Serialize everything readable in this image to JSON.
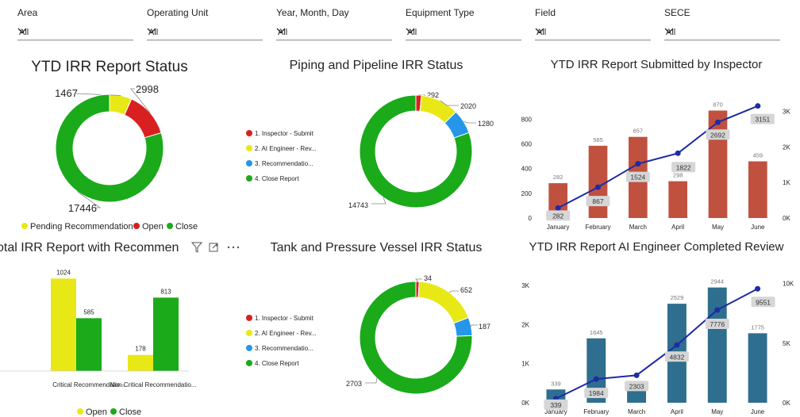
{
  "filters": [
    {
      "label": "Area",
      "value": "All"
    },
    {
      "label": "Operating Unit",
      "value": "All"
    },
    {
      "label": "Year, Month, Day",
      "value": "All"
    },
    {
      "label": "Equipment Type",
      "value": "All"
    },
    {
      "label": "Field",
      "value": "All"
    },
    {
      "label": "SECE",
      "value": "All"
    }
  ],
  "visual_header_icons": [
    "filter-icon",
    "focus-mode-icon",
    "more-options-icon"
  ],
  "colors": {
    "red": "#d92020",
    "yellow": "#e8e817",
    "green": "#1aaa1a",
    "blue": "#2596e8",
    "bar_red": "#c0513f",
    "bar_teal": "#2e6e8e",
    "line": "#1e2ba5"
  },
  "chart_data": [
    {
      "type": "pie",
      "title": "YTD IRR Report Status",
      "hole": "donut",
      "slices": [
        {
          "label": "Pending Recommendation",
          "value": 1467,
          "color": "#e8e817"
        },
        {
          "label": "Open",
          "value": 2998,
          "color": "#d92020"
        },
        {
          "label": "Close",
          "value": 17446,
          "color": "#1aaa1a"
        }
      ],
      "legend": [
        "Pending Recommendation",
        "Open",
        "Close"
      ],
      "legend_position": "bottom"
    },
    {
      "type": "pie",
      "title": "Piping and Pipeline IRR Status",
      "hole": "donut",
      "slices": [
        {
          "label": "1. Inspector - Submit",
          "value": 292,
          "color": "#d92020"
        },
        {
          "label": "2. AI Engineer - Rev...",
          "value": 2020,
          "color": "#e8e817"
        },
        {
          "label": "3. Recommendatio...",
          "value": 1280,
          "color": "#2596e8"
        },
        {
          "label": "4. Close Report",
          "value": 14743,
          "color": "#1aaa1a"
        }
      ],
      "legend": [
        "1. Inspector - Submit",
        "2. AI Engineer - Rev...",
        "3. Recommendatio...",
        "4. Close Report"
      ],
      "legend_position": "left"
    },
    {
      "type": "bar",
      "title": "YTD IRR Report Submitted by Inspector",
      "categories": [
        "January",
        "February",
        "March",
        "April",
        "May",
        "June"
      ],
      "series": [
        {
          "values": [
            282,
            585,
            657,
            298,
            870,
            459
          ],
          "kind": "bar",
          "color": "#c0513f"
        },
        {
          "values": [
            282,
            867,
            1524,
            1822,
            2692,
            3151
          ],
          "kind": "line",
          "color": "#1e2ba5"
        }
      ],
      "y_ticks": [
        "0",
        "200",
        "400",
        "600",
        "800"
      ],
      "y_max": 950,
      "y2_ticks": [
        "0K",
        "1K",
        "2K",
        "3K"
      ],
      "y2_max": 3300
    },
    {
      "type": "bar",
      "title": "Total IRR Report with Recommendations",
      "title_visible": "otal IRR Report with Recommen",
      "categories": [
        "Critical Recommendatio...",
        "Non-Critical Recommendatio..."
      ],
      "series": [
        {
          "name": "Open",
          "values": [
            1024,
            178
          ],
          "color": "#e8e817"
        },
        {
          "name": "Close",
          "values": [
            585,
            813
          ],
          "color": "#1aaa1a"
        }
      ],
      "legend": [
        "Open",
        "Close"
      ],
      "legend_position": "bottom",
      "y_max": 1080
    },
    {
      "type": "pie",
      "title": "Tank and Pressure Vessel IRR Status",
      "hole": "donut",
      "slices": [
        {
          "label": "1. Inspector - Submit",
          "value": 34,
          "color": "#d92020"
        },
        {
          "label": "2. AI Engineer - Rev...",
          "value": 652,
          "color": "#e8e817"
        },
        {
          "label": "3. Recommendatio...",
          "value": 187,
          "color": "#2596e8"
        },
        {
          "label": "4. Close Report",
          "value": 2703,
          "color": "#1aaa1a"
        }
      ],
      "legend": [
        "1. Inspector - Submit",
        "2. AI Engineer - Rev...",
        "3. Recommendatio...",
        "4. Close Report"
      ],
      "legend_position": "left"
    },
    {
      "type": "bar",
      "title": "YTD IRR Report AI Engineer Completed Review",
      "categories": [
        "January",
        "February",
        "March",
        "April",
        "May",
        "June"
      ],
      "series": [
        {
          "values": [
            339,
            1645,
            319,
            2529,
            2944,
            1775
          ],
          "kind": "bar",
          "color": "#2e6e8e"
        },
        {
          "values": [
            339,
            1984,
            2303,
            4832,
            7776,
            9551
          ],
          "kind": "line",
          "color": "#1e2ba5"
        }
      ],
      "y_ticks": [
        "0K",
        "1K",
        "2K",
        "3K"
      ],
      "y_max": 3200,
      "y2_ticks": [
        "0K",
        "5K",
        "10K"
      ],
      "y2_max": 10500
    }
  ]
}
